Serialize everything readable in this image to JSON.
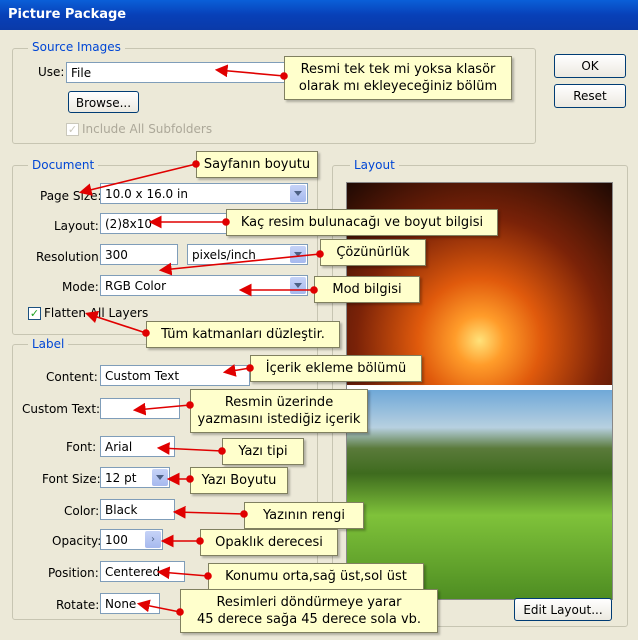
{
  "window": {
    "title": "Picture Package"
  },
  "source_images": {
    "legend": "Source Images",
    "use_label": "Use:",
    "use_value": "File",
    "browse_label": "Browse...",
    "include_subfolders_label": "Include All Subfolders"
  },
  "document": {
    "legend": "Document",
    "page_size_label": "Page Size:",
    "page_size_value": "10.0 x 16.0 in",
    "layout_label": "Layout:",
    "layout_value": "(2)8x10",
    "resolution_label": "Resolution:",
    "resolution_value": "300",
    "resolution_unit": "pixels/inch",
    "mode_label": "Mode:",
    "mode_value": "RGB Color",
    "flatten_label": "Flatten All Layers"
  },
  "label": {
    "legend": "Label",
    "content_label": "Content:",
    "content_value": "Custom Text",
    "custom_text_label": "Custom Text:",
    "custom_text_value": "",
    "font_label": "Font:",
    "font_value": "Arial",
    "font_size_label": "Font Size:",
    "font_size_value": "12 pt",
    "color_label": "Color:",
    "color_value": "Black",
    "opacity_label": "Opacity:",
    "opacity_value": "100",
    "opacity_arrow": "›",
    "position_label": "Position:",
    "position_value": "Centered",
    "rotate_label": "Rotate:",
    "rotate_value": "None"
  },
  "layout_panel": {
    "legend": "Layout",
    "edit_layout_label": "Edit Layout..."
  },
  "buttons": {
    "ok": "OK",
    "reset": "Reset"
  },
  "callouts": {
    "use_line1": "Resmi tek tek mi yoksa klasör",
    "use_line2": "olarak mı ekleyeceğiniz bölüm",
    "page_size": "Sayfanın boyutu",
    "layout": "Kaç resim bulunacağı ve boyut bilgisi",
    "resolution": "Çözünürlük",
    "mode": "Mod bilgisi",
    "flatten": "Tüm katmanları düzleştir.",
    "content": "İçerik ekleme bölümü",
    "custom_text_line1": "Resmin üzerinde",
    "custom_text_line2": "yazmasını istediğiz içerik",
    "font": "Yazı tipi",
    "font_size": "Yazı Boyutu",
    "color": "Yazının rengi",
    "opacity": "Opaklık derecesi",
    "position": "Konumu orta,sağ üst,sol üst",
    "rotate_line1": "Resimleri döndürmeye yarar",
    "rotate_line2": "45 derece sağa 45 derece sola vb."
  },
  "colors": {
    "title_bar": "#0a5fd8",
    "legend_text": "#0046d5",
    "callout_bg": "#ffffcc",
    "arrow": "#e00000"
  }
}
